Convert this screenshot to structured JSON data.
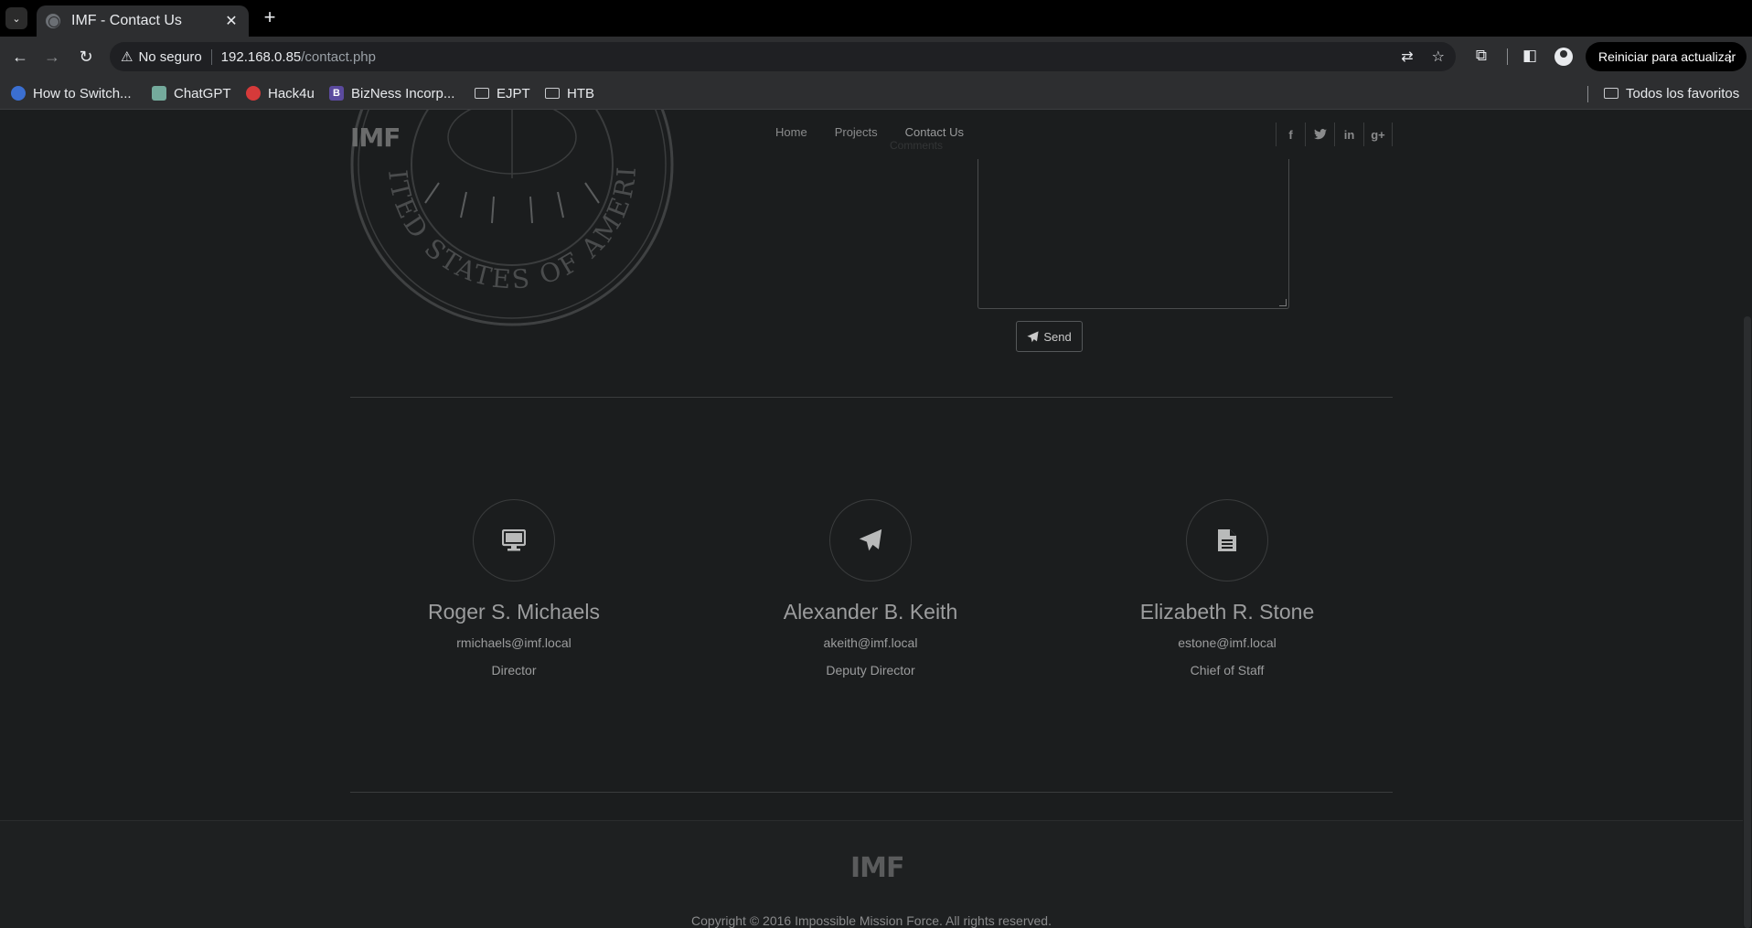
{
  "browser": {
    "tab_title": "IMF - Contact Us",
    "security_label": "No seguro",
    "url_host": "192.168.0.85",
    "url_path": "/contact.php",
    "restart_label": "Reiniciar para actualizar",
    "bookmarks": [
      {
        "label": "How to Switch...",
        "icon": "bookmark-favicon"
      },
      {
        "label": "ChatGPT",
        "icon": "chatgpt-favicon"
      },
      {
        "label": "Hack4u",
        "icon": "hack4u-favicon"
      },
      {
        "label": "BizNess Incorp...",
        "icon": "bizness-favicon"
      },
      {
        "label": "EJPT",
        "icon": "folder-icon"
      },
      {
        "label": "HTB",
        "icon": "folder-icon"
      }
    ],
    "all_bookmarks_label": "Todos los favoritos"
  },
  "site": {
    "brand": "IMF",
    "nav": [
      "Home",
      "Projects",
      "Contact Us"
    ],
    "nav_ghost_text": "Comments",
    "seal_text": "UNITED STATES OF AMERICA",
    "socials": [
      "facebook-icon",
      "twitter-icon",
      "linkedin-icon",
      "google-plus-icon"
    ],
    "send_label": "Send"
  },
  "contacts": [
    {
      "icon": "monitor-icon",
      "name": "Roger S. Michaels",
      "email": "rmichaels@imf.local",
      "role": "Director"
    },
    {
      "icon": "paper-plane-icon",
      "name": "Alexander B. Keith",
      "email": "akeith@imf.local",
      "role": "Deputy Director"
    },
    {
      "icon": "document-icon",
      "name": "Elizabeth R. Stone",
      "email": "estone@imf.local",
      "role": "Chief of Staff"
    }
  ],
  "footer": {
    "logo": "IMF",
    "copyright": "Copyright © 2016 Impossible Mission Force. All rights reserved."
  }
}
